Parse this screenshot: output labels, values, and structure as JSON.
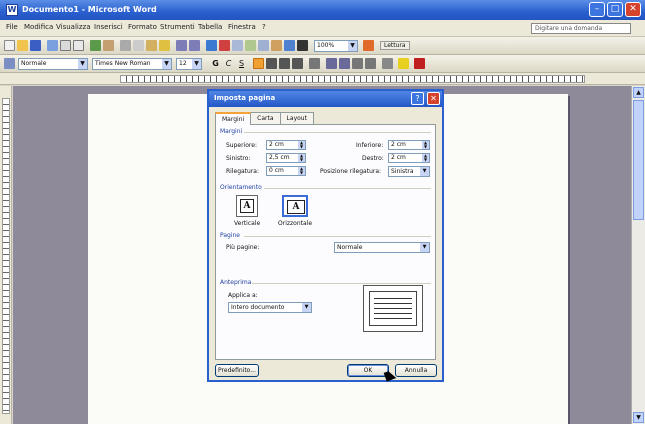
{
  "window": {
    "title": "Documento1 - Microsoft Word"
  },
  "menubar": {
    "items": [
      "File",
      "Modifica",
      "Visualizza",
      "Inserisci",
      "Formato",
      "Strumenti",
      "Tabella",
      "Finestra",
      "?"
    ],
    "help_placeholder": "Digitare una domanda"
  },
  "toolbar": {
    "zoom": "100%",
    "read_button": "Lettura",
    "style": "Normale",
    "font": "Times New Roman",
    "size": "12"
  },
  "dialog": {
    "title": "Imposta pagina",
    "tabs": [
      "Margini",
      "Carta",
      "Layout"
    ],
    "margins_group": "Margini",
    "fields": {
      "superiore_label": "Superiore:",
      "superiore": "2 cm",
      "sinistro_label": "Sinistro:",
      "sinistro": "2,5 cm",
      "rilegatura_label": "Rilegatura:",
      "rilegatura": "0 cm",
      "inferiore_label": "Inferiore:",
      "inferiore": "2 cm",
      "destro_label": "Destro:",
      "destro": "2 cm",
      "posizione_label": "Posizione rilegatura:",
      "posizione": "Sinistra"
    },
    "orientation_group": "Orientamento",
    "orientation": {
      "portrait": "Verticale",
      "landscape": "Orizzontale",
      "selected": "landscape"
    },
    "pages_group": "Pagine",
    "piu_pagine_label": "Più pagine:",
    "piu_pagine": "Normale",
    "preview_group": "Anteprima",
    "applica_label": "Applica a:",
    "applica": "Intero documento",
    "buttons": {
      "default": "Predefinito...",
      "ok": "OK",
      "cancel": "Annulla"
    }
  },
  "colors": {
    "accent": "#2a5fcf",
    "workspace": "#8e8a9a",
    "dialog_bg": "#ece9d8"
  }
}
